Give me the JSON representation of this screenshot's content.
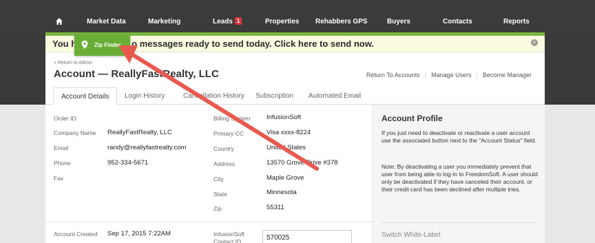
{
  "nav": {
    "home_icon": "home-icon",
    "items": [
      {
        "label": "Market Data"
      },
      {
        "label": "Marketing"
      },
      {
        "label": "Leads",
        "badge": "1"
      },
      {
        "label": "Properties"
      },
      {
        "label": "Rehabbers GPS"
      },
      {
        "label": "Buyers"
      },
      {
        "label": "Contacts"
      },
      {
        "label": "Reports"
      }
    ]
  },
  "banner": {
    "text_start": "You h",
    "text_end": "o messages ready to send today. Click here to send now.",
    "close_icon": "close-icon"
  },
  "zip_finder": {
    "label": "Zip Finder",
    "icon": "map-pin-icon"
  },
  "header": {
    "back_link": "« Return to Admin",
    "title": "Account — ReallyFastRealty, LLC",
    "actions": [
      "Return To Accounts",
      "Manage Users",
      "Become Manager"
    ]
  },
  "tabs": [
    {
      "label": "Account Details",
      "active": true
    },
    {
      "label": "Login History"
    },
    {
      "label": "Cancellation History"
    },
    {
      "label": "Subscription"
    },
    {
      "label": "Automated Email"
    }
  ],
  "details_left": [
    {
      "label": "Order ID",
      "value": ""
    },
    {
      "label": "Company Name",
      "value": "ReallyFastRealty, LLC"
    },
    {
      "label": "Email",
      "value": "randy@reallyfastrealty.com"
    },
    {
      "label": "Phone",
      "value": "952-334-5671"
    },
    {
      "label": "Fax",
      "value": ""
    }
  ],
  "details_right": [
    {
      "label": "Billing System",
      "value": "InfusionSoft"
    },
    {
      "label": "Primary CC",
      "value": "Visa xxxx-8224"
    },
    {
      "label": "Country",
      "value": "United States"
    },
    {
      "label": "Address",
      "value": "13570 Grove Drive #378"
    },
    {
      "label": "City",
      "value": "Maple Grove"
    },
    {
      "label": "State",
      "value": "Minnesota"
    },
    {
      "label": "Zip",
      "value": "55311"
    }
  ],
  "lower": {
    "created_label": "Account Created",
    "created_value": "Sep 17, 2015 7:22AM",
    "contact_label": "InfusionSoft Contact ID",
    "contact_value": "570025"
  },
  "profile": {
    "title": "Account Profile",
    "p1": "If you just need to deactivate or reactivate a user account use the associated button next to the \"Account Status\" field.",
    "p2": "Note: By deactivating a user you immediately prevent that user from being able to log-in to FreedomSoft. A user should only be deactivated if they have canceled their account, or their credit card has been declined after multiple tries.",
    "switch_label": "Switch White-Label"
  },
  "colors": {
    "accent_green": "#7ab741",
    "arrow_red": "#e85a4f",
    "badge_red": "#d9343a"
  }
}
